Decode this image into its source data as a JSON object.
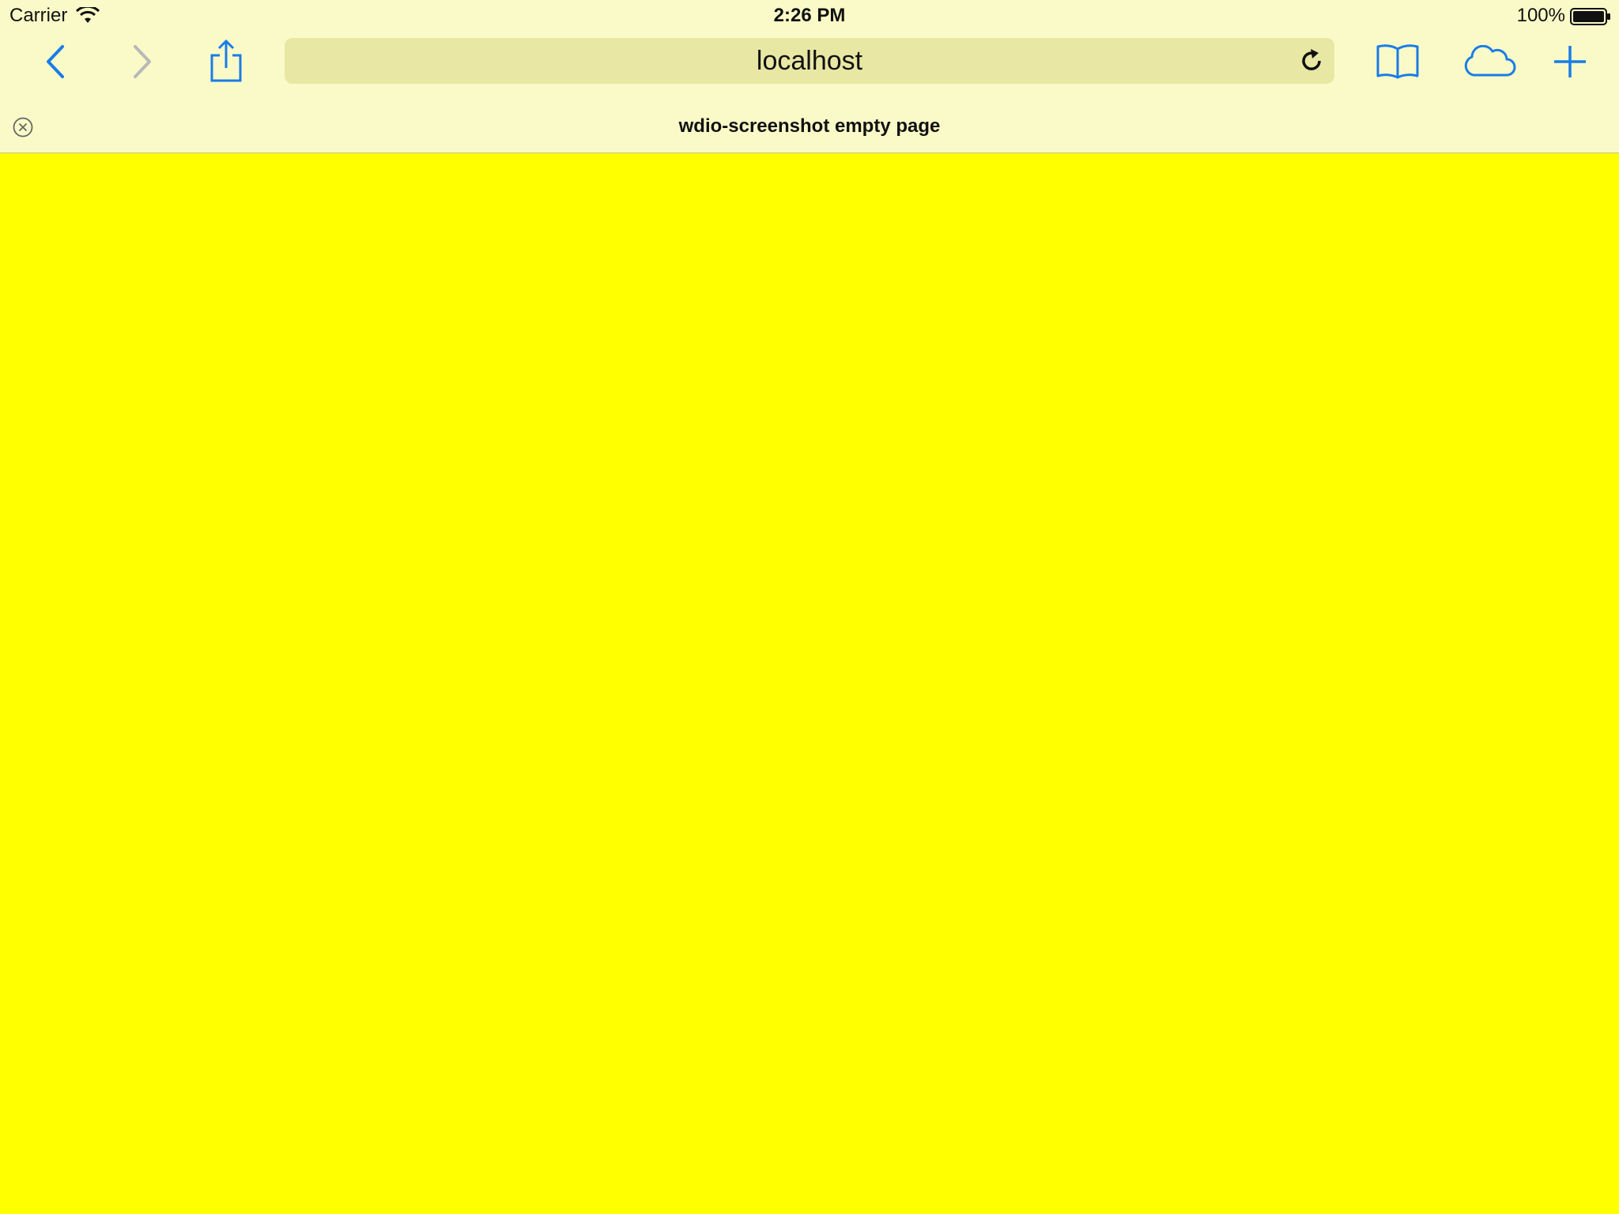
{
  "status_bar": {
    "carrier": "Carrier",
    "time": "2:26 PM",
    "battery_percent": "100%"
  },
  "toolbar": {
    "address": "localhost",
    "icons": [
      "back-icon",
      "forward-icon",
      "share-icon",
      "reload-icon",
      "bookmarks-icon",
      "cloud-tabs-icon",
      "new-tab-icon"
    ]
  },
  "tab": {
    "title": "wdio-screenshot empty page"
  },
  "colors": {
    "chrome_background": "#fafac8",
    "address_bar": "#e8e8a4",
    "page_background": "#ffff00",
    "accent": "#1a7ce8",
    "disabled": "#b8b8b8"
  }
}
